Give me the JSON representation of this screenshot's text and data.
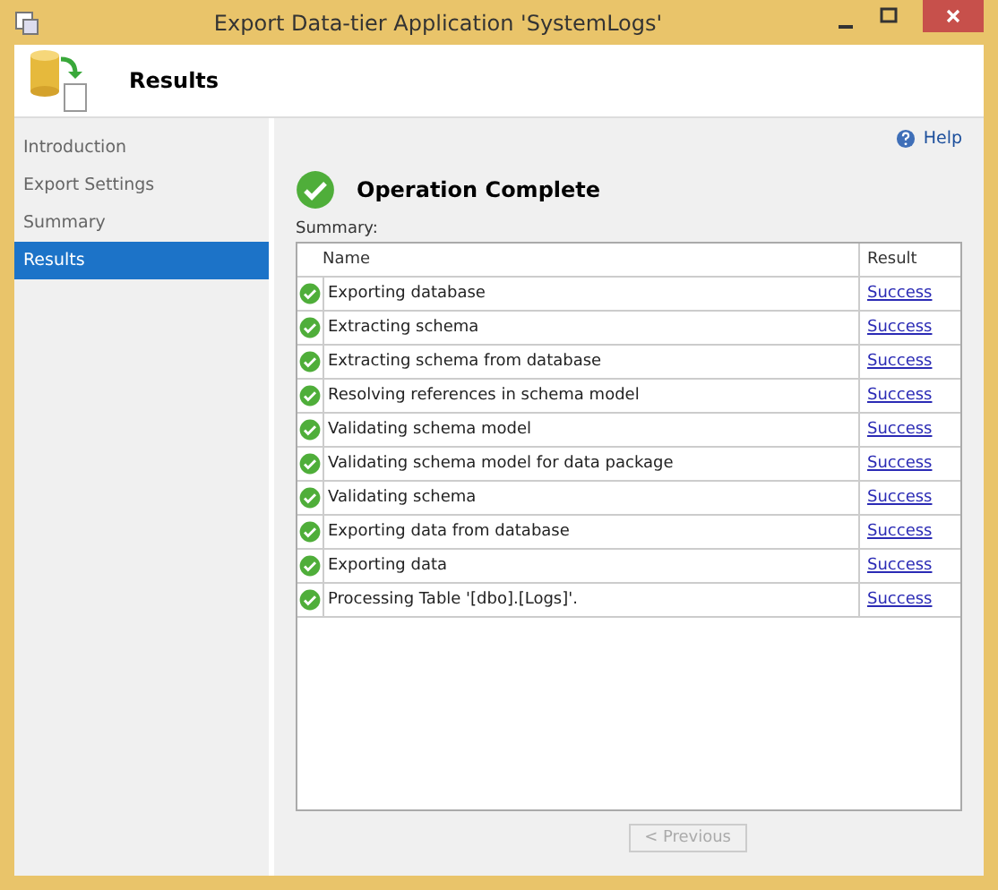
{
  "window": {
    "title": "Export Data-tier Application 'SystemLogs'"
  },
  "header": {
    "title": "Results"
  },
  "sidebar": {
    "items": [
      {
        "label": "Introduction",
        "selected": false
      },
      {
        "label": "Export Settings",
        "selected": false
      },
      {
        "label": "Summary",
        "selected": false
      },
      {
        "label": "Results",
        "selected": true
      }
    ]
  },
  "help": {
    "label": "Help"
  },
  "status": {
    "title": "Operation Complete"
  },
  "summary": {
    "label": "Summary:",
    "columns": [
      "Name",
      "Result"
    ],
    "rows": [
      {
        "name": "Exporting database",
        "result": "Success"
      },
      {
        "name": "Extracting schema",
        "result": "Success"
      },
      {
        "name": "Extracting schema from database",
        "result": "Success"
      },
      {
        "name": "Resolving references in schema model",
        "result": "Success"
      },
      {
        "name": "Validating schema model",
        "result": "Success"
      },
      {
        "name": "Validating schema model for data package",
        "result": "Success"
      },
      {
        "name": "Validating schema",
        "result": "Success"
      },
      {
        "name": "Exporting data from database",
        "result": "Success"
      },
      {
        "name": "Exporting data",
        "result": "Success"
      },
      {
        "name": "Processing Table '[dbo].[Logs]'.",
        "result": "Success"
      }
    ]
  },
  "buttons": [
    {
      "label": "< Previous",
      "disabled": true
    }
  ]
}
